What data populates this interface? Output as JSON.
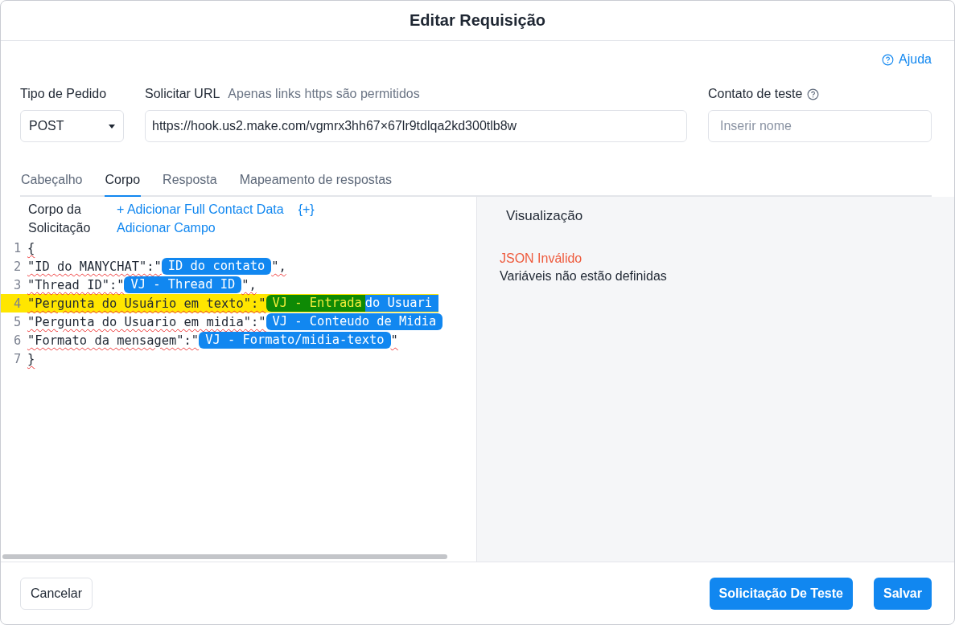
{
  "dialog": {
    "title": "Editar Requisição"
  },
  "help_link": "Ajuda",
  "request_type": {
    "label": "Tipo de Pedido",
    "value": "POST"
  },
  "url": {
    "label": "Solicitar URL",
    "hint": "Apenas links https são permitidos",
    "value": "https://hook.us2.make.com/vgmrx3hh67×67lr9tdlqa2kd300tlb8w"
  },
  "test_contact": {
    "label": "Contato de teste",
    "placeholder": "Inserir nome"
  },
  "tabs": [
    {
      "label": "Cabeçalho",
      "selected": false
    },
    {
      "label": "Corpo",
      "selected": true
    },
    {
      "label": "Resposta",
      "selected": false
    },
    {
      "label": "Mapeamento de respostas",
      "selected": false
    }
  ],
  "body_editor": {
    "title": "Corpo da Solicitação",
    "add_full_contact": "+ Adicionar Full Contact Data",
    "add_field": "Adicionar Campo",
    "insert_variable": "{+}",
    "lines": [
      {
        "number": "1",
        "highlighted": false,
        "segments": [
          {
            "kind": "text",
            "text": "{"
          }
        ]
      },
      {
        "number": "2",
        "highlighted": false,
        "segments": [
          {
            "kind": "text",
            "text": "\"ID do MANYCHAT\":\""
          },
          {
            "kind": "tag",
            "text": "ID do contato",
            "selected": false
          },
          {
            "kind": "text",
            "text": "\","
          }
        ]
      },
      {
        "number": "3",
        "highlighted": false,
        "segments": [
          {
            "kind": "text",
            "text": "\"Thread ID\":\""
          },
          {
            "kind": "tag",
            "text": "VJ - Thread ID",
            "selected": false
          },
          {
            "kind": "text",
            "text": "\","
          }
        ]
      },
      {
        "number": "4",
        "highlighted": true,
        "segments": [
          {
            "kind": "text",
            "text": "\"Pergunta do Usuário em texto\":\""
          },
          {
            "kind": "tag",
            "text": "VJ - Entrada",
            "selected": true
          },
          {
            "kind": "tag",
            "text": "do Usuari",
            "selected": false
          }
        ]
      },
      {
        "number": "5",
        "highlighted": false,
        "segments": [
          {
            "kind": "text",
            "text": "\"Pergunta do Usuario em midia\":\""
          },
          {
            "kind": "tag",
            "text": "VJ - Conteudo de Midia",
            "selected": false
          }
        ]
      },
      {
        "number": "6",
        "highlighted": false,
        "segments": [
          {
            "kind": "text",
            "text": "\"Formato da mensagem\":\""
          },
          {
            "kind": "tag",
            "text": "VJ - Formato/midia-texto",
            "selected": false
          },
          {
            "kind": "text",
            "text": "\""
          }
        ]
      },
      {
        "number": "7",
        "highlighted": false,
        "segments": [
          {
            "kind": "text",
            "text": "}"
          }
        ]
      }
    ]
  },
  "preview": {
    "title": "Visualização",
    "error": "JSON Inválido",
    "message": "Variáveis não estão definidas"
  },
  "buttons": {
    "cancel": "Cancelar",
    "test": "Solicitação De Teste",
    "save": "Salvar"
  }
}
